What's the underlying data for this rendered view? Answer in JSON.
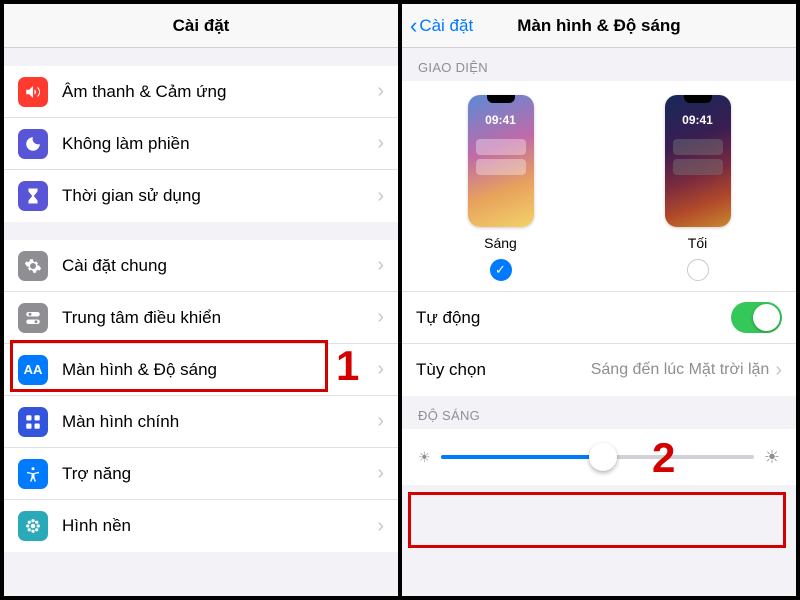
{
  "left": {
    "title": "Cài đặt",
    "groups": [
      [
        {
          "icon": "speaker-icon",
          "bg": "bg-red",
          "label": "Âm thanh & Cảm ứng"
        },
        {
          "icon": "moon-icon",
          "bg": "bg-purple",
          "label": "Không làm phiền"
        },
        {
          "icon": "hourglass-icon",
          "bg": "bg-purple2",
          "label": "Thời gian sử dụng"
        }
      ],
      [
        {
          "icon": "gear-icon",
          "bg": "bg-gray",
          "label": "Cài đặt chung"
        },
        {
          "icon": "switches-icon",
          "bg": "bg-gray2",
          "label": "Trung tâm điều khiển"
        },
        {
          "icon": "text-aa-icon",
          "bg": "bg-blue",
          "label": "Màn hình & Độ sáng",
          "highlight": true
        },
        {
          "icon": "grid-icon",
          "bg": "bg-indigo",
          "label": "Màn hình chính"
        },
        {
          "icon": "accessibility-icon",
          "bg": "bg-blue2",
          "label": "Trợ năng"
        },
        {
          "icon": "flower-icon",
          "bg": "bg-teal",
          "label": "Hình nền"
        }
      ]
    ]
  },
  "right": {
    "back": "Cài đặt",
    "title": "Màn hình & Độ sáng",
    "appearance_section": "GIAO DIỆN",
    "phone_time": "09:41",
    "light_label": "Sáng",
    "dark_label": "Tối",
    "auto_label": "Tự động",
    "auto_on": true,
    "options_label": "Tùy chọn",
    "options_value": "Sáng đến lúc Mặt trời lặn",
    "brightness_section": "ĐỘ SÁNG",
    "brightness_pct": 52
  },
  "callouts": {
    "one": "1",
    "two": "2"
  }
}
